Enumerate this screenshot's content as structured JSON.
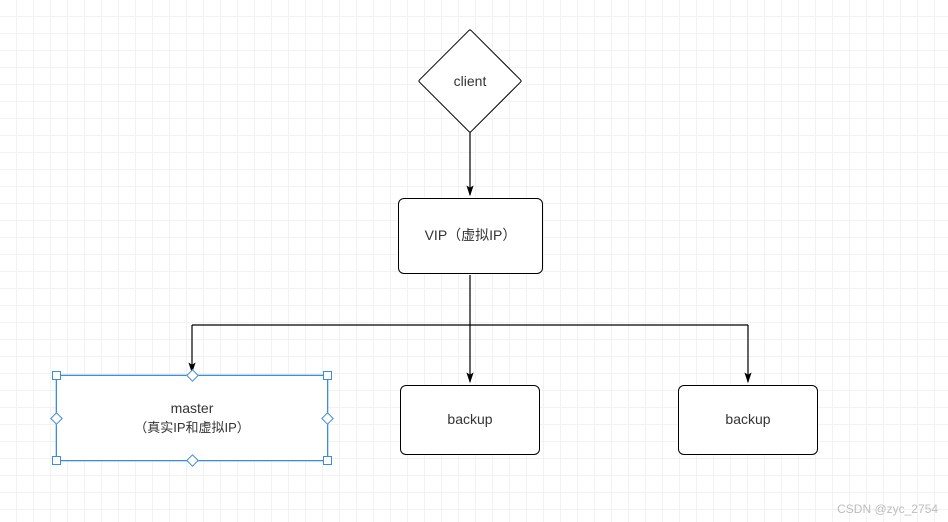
{
  "nodes": {
    "client": {
      "label": "client"
    },
    "vip": {
      "label": "VIP（虚拟IP）"
    },
    "master": {
      "label": "master",
      "sublabel": "（真实IP和虚拟IP）"
    },
    "backup1": {
      "label": "backup"
    },
    "backup2": {
      "label": "backup"
    }
  },
  "watermark": "CSDN @zyc_2754",
  "chart_data": {
    "type": "flowchart",
    "title": "",
    "nodes": [
      {
        "id": "client",
        "shape": "decision",
        "label": "client"
      },
      {
        "id": "vip",
        "shape": "process",
        "label": "VIP（虚拟IP）"
      },
      {
        "id": "master",
        "shape": "process",
        "label": "master（真实IP和虚拟IP）",
        "selected": true
      },
      {
        "id": "backup1",
        "shape": "process",
        "label": "backup"
      },
      {
        "id": "backup2",
        "shape": "process",
        "label": "backup"
      }
    ],
    "edges": [
      {
        "from": "client",
        "to": "vip",
        "arrow": true
      },
      {
        "from": "vip",
        "to": "master",
        "arrow": true
      },
      {
        "from": "vip",
        "to": "backup1",
        "arrow": true
      },
      {
        "from": "vip",
        "to": "backup2",
        "arrow": true
      }
    ]
  }
}
